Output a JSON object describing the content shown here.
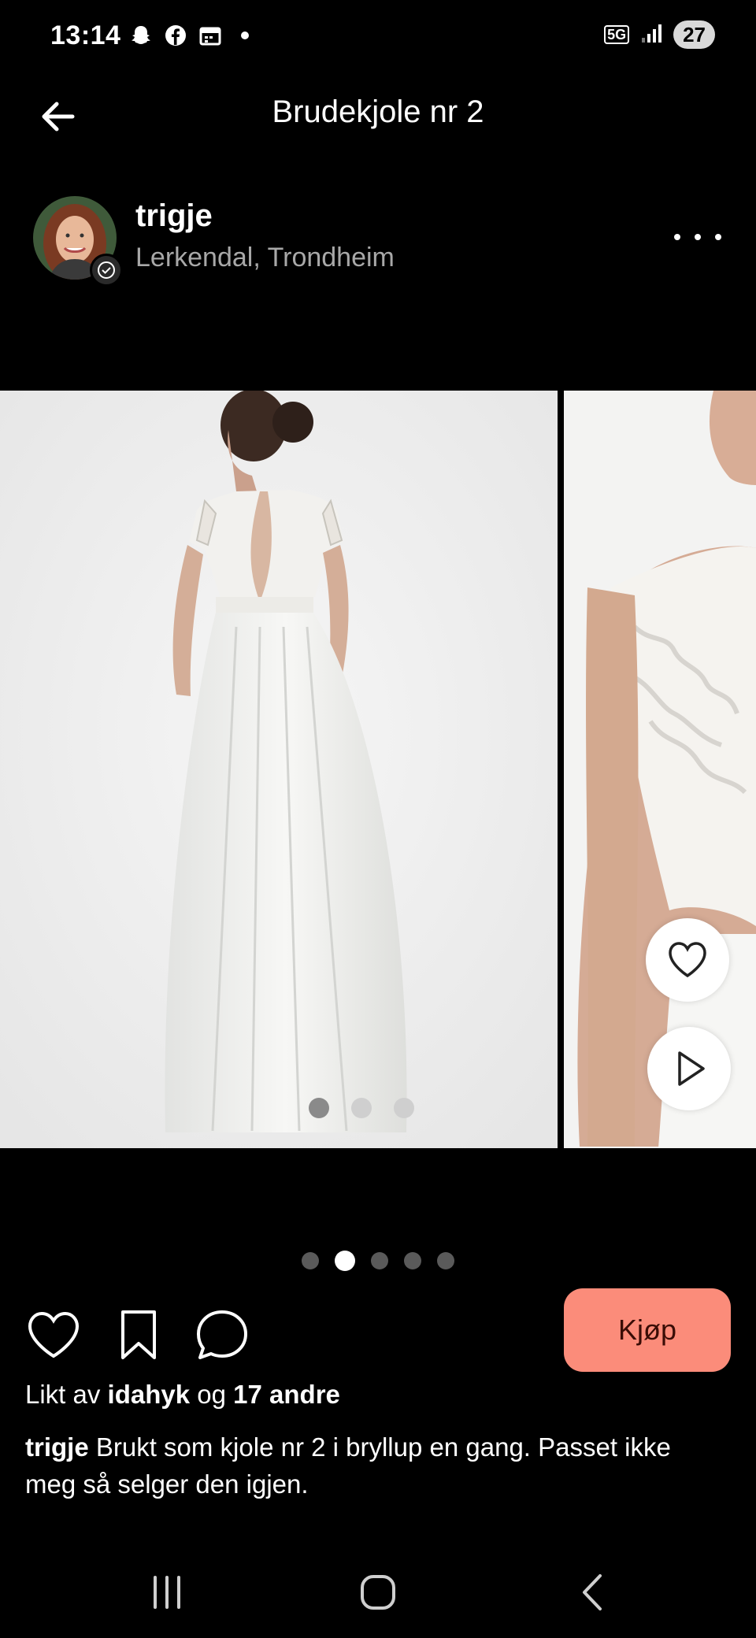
{
  "status_bar": {
    "time": "13:14",
    "network": "5G",
    "battery": "27"
  },
  "header": {
    "title": "Brudekjole nr 2"
  },
  "seller": {
    "username": "trigje",
    "location": "Lerkendal, Trondheim"
  },
  "gallery": {
    "page_count": 5,
    "active_index": 1
  },
  "actions": {
    "buy_label": "Kjøp"
  },
  "likes": {
    "prefix": "Likt av",
    "user": "idahyk",
    "joiner": "og",
    "others": "17 andre"
  },
  "caption": {
    "username": "trigje",
    "text": "Brukt som kjole nr 2 i bryllup en gang. Passet ikke meg så selger den igjen."
  },
  "icons": [
    "snapchat-icon",
    "facebook-icon",
    "calendar-icon",
    "signal-icon",
    "back-arrow-icon",
    "more-icon",
    "heart-icon",
    "bookmark-icon",
    "comment-icon",
    "play-icon",
    "recent-apps-icon",
    "home-icon",
    "nav-back-icon"
  ],
  "colors": {
    "buy_button": "#fb8c7a",
    "background": "#000000"
  }
}
